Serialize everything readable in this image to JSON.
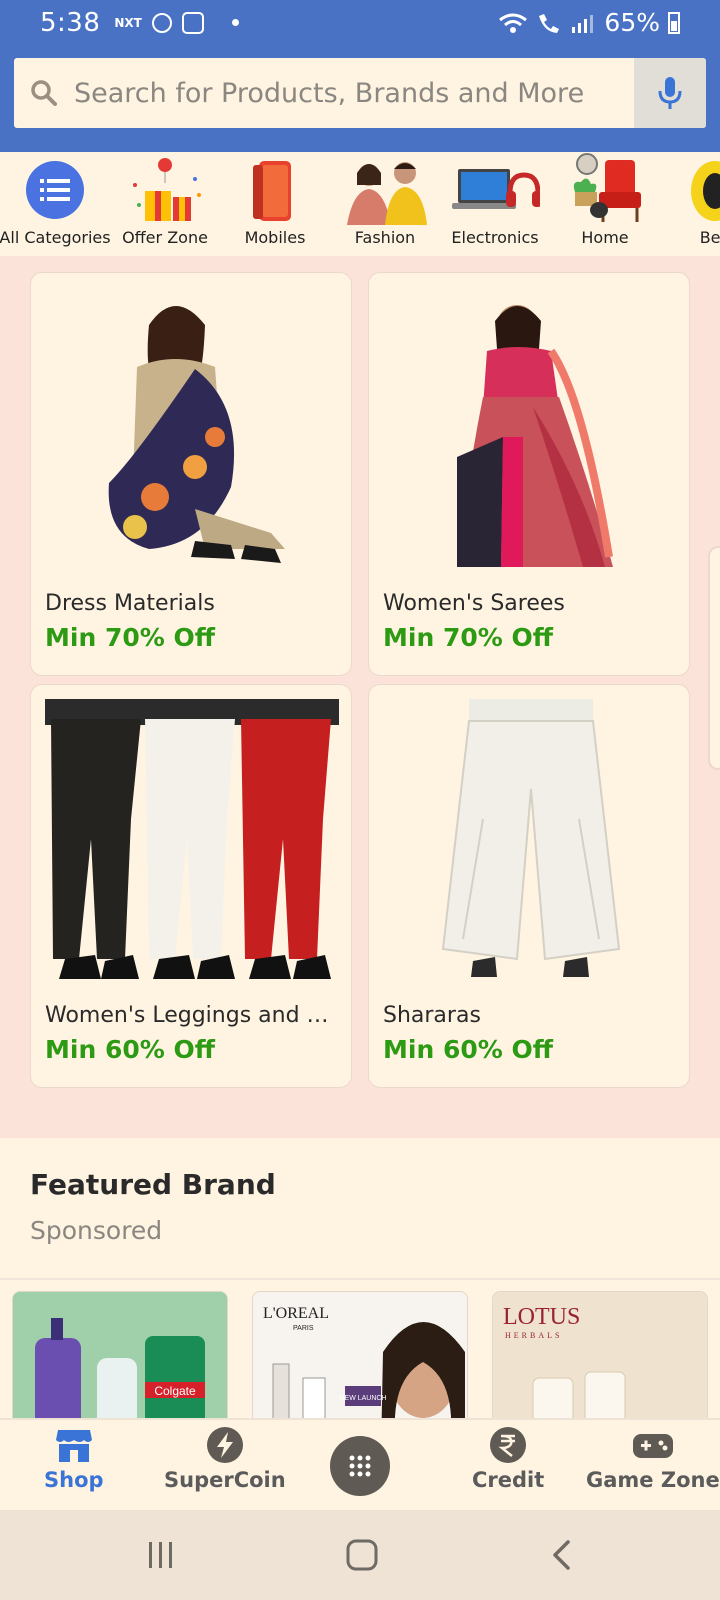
{
  "status_bar": {
    "time": "5:38",
    "carrier_tag": "NXT",
    "battery": "65%"
  },
  "search": {
    "placeholder": "Search for Products, Brands and More"
  },
  "categories": [
    {
      "label": "All Categories",
      "icon": "list-icon"
    },
    {
      "label": "Offer Zone",
      "icon": "gift-icon"
    },
    {
      "label": "Mobiles",
      "icon": "phone-icon"
    },
    {
      "label": "Fashion",
      "icon": "fashion-icon"
    },
    {
      "label": "Electronics",
      "icon": "laptop-icon"
    },
    {
      "label": "Home",
      "icon": "chair-icon"
    },
    {
      "label": "Bea",
      "icon": "beauty-icon"
    }
  ],
  "products": [
    {
      "title": "Dress Materials",
      "offer": "Min 70% Off"
    },
    {
      "title": "Women's Sarees",
      "offer": "Min 70% Off"
    },
    {
      "title": "Women's Leggings and Chu...",
      "offer": "Min 60% Off"
    },
    {
      "title": "Shararas",
      "offer": "Min 60% Off"
    }
  ],
  "featured": {
    "title": "Featured Brand",
    "subtitle": "Sponsored"
  },
  "brands": [
    {
      "name": "Palmolive / Colgate",
      "logo_text": "Colgate"
    },
    {
      "name": "L'OREAL",
      "logo_text": "L'OREAL",
      "logo_sub": "PARIS",
      "badge": "NEW LAUNCH"
    },
    {
      "name": "LOTUS HERBALS",
      "logo_text": "LOTUS",
      "logo_sub": "HERBALS"
    }
  ],
  "bottom_nav": [
    {
      "label": "Shop",
      "icon": "shop-icon",
      "active": true
    },
    {
      "label": "SuperCoin",
      "icon": "supercoin-icon",
      "active": false
    },
    {
      "label": "Credit",
      "icon": "rupee-icon",
      "active": false
    },
    {
      "label": "Game Zone",
      "icon": "gamepad-icon",
      "active": false
    }
  ],
  "colors": {
    "brand_blue": "#4a72c4",
    "offer_green": "#2d9a14",
    "active_blue": "#3a74d6"
  }
}
